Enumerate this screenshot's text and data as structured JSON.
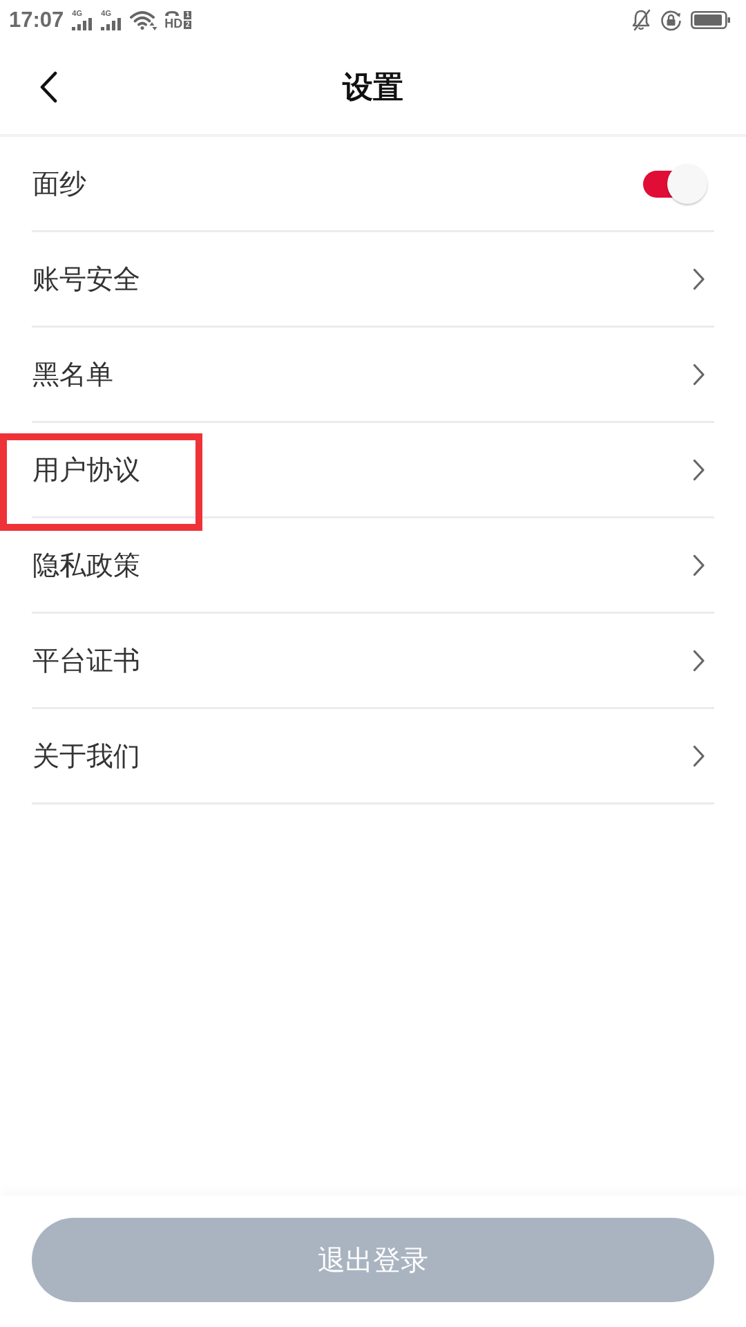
{
  "status_bar": {
    "time": "17:07",
    "networks": [
      {
        "label": "4G"
      },
      {
        "label": "4G"
      }
    ],
    "hd": {
      "label": "HD",
      "sims": [
        "1",
        "2"
      ]
    }
  },
  "header": {
    "title": "设置"
  },
  "settings": [
    {
      "kind": "toggle",
      "label": "面纱",
      "on": true,
      "highlighted": false
    },
    {
      "kind": "link",
      "label": "账号安全",
      "highlighted": false
    },
    {
      "kind": "link",
      "label": "黑名单",
      "highlighted": false
    },
    {
      "kind": "link",
      "label": "用户协议",
      "highlighted": true
    },
    {
      "kind": "link",
      "label": "隐私政策",
      "highlighted": false
    },
    {
      "kind": "link",
      "label": "平台证书",
      "highlighted": false
    },
    {
      "kind": "link",
      "label": "关于我们",
      "highlighted": false
    }
  ],
  "logout_button": {
    "label": "退出登录"
  }
}
